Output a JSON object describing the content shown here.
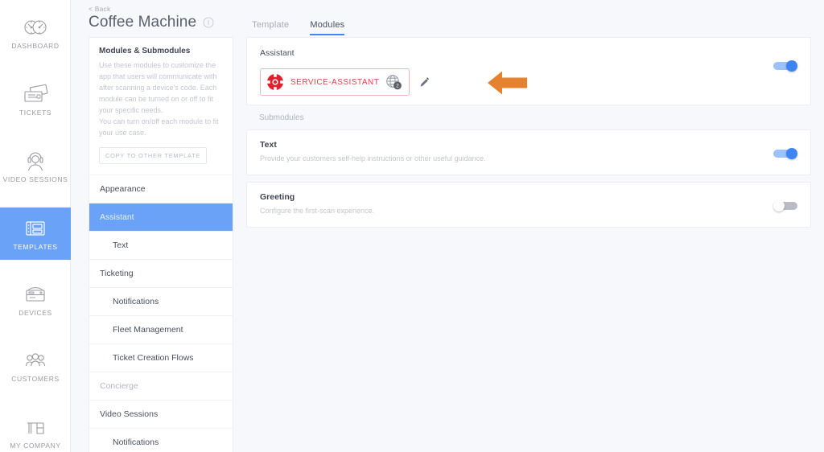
{
  "colors": {
    "accent_blue": "#6aa2f7",
    "tab_underline": "#4287f5",
    "chip_red": "#e0404f",
    "chip_border": "#f0b3bb",
    "toggle_on": "#3d84f5",
    "toggle_off": "#b9bcc6",
    "annotation_orange": "#e5822f",
    "page_bg": "#f7f8fc"
  },
  "rail": {
    "items": [
      {
        "label": "DASHBOARD",
        "icon": "dashboard-gauges-icon",
        "active": false
      },
      {
        "label": "TICKETS",
        "icon": "tickets-icon",
        "active": false
      },
      {
        "label": "VIDEO SESSIONS",
        "icon": "headset-agent-icon",
        "active": false
      },
      {
        "label": "TEMPLATES",
        "icon": "templates-grid-icon",
        "active": true
      },
      {
        "label": "DEVICES",
        "icon": "printer-device-icon",
        "active": false
      },
      {
        "label": "CUSTOMERS",
        "icon": "people-group-icon",
        "active": false
      },
      {
        "label": "MY COMPANY",
        "icon": "desk-icon",
        "active": false
      }
    ]
  },
  "header": {
    "back_label": "< Back",
    "title": "Coffee Machine",
    "info_icon": "info-circle-icon",
    "tabs": [
      {
        "label": "Template",
        "active": false
      },
      {
        "label": "Modules",
        "active": true
      }
    ]
  },
  "left_panel": {
    "title": "Modules & Submodules",
    "description_lines": [
      "Use these modules to customize the",
      "app that users will communicate with",
      "after scanning a device's code. Each",
      "module can be turned on or off to fit",
      "your specific needs.",
      "You can turn on/off each module to fit",
      "your use case."
    ],
    "copy_button_label": "COPY TO OTHER TEMPLATE",
    "nav_items": [
      {
        "label": "Appearance",
        "level": 0,
        "selected": false,
        "muted": false
      },
      {
        "label": "Assistant",
        "level": 0,
        "selected": true,
        "muted": false
      },
      {
        "label": "Text",
        "level": 1,
        "selected": false,
        "muted": false
      },
      {
        "label": "Ticketing",
        "level": 0,
        "selected": false,
        "muted": false
      },
      {
        "label": "Notifications",
        "level": 1,
        "selected": false,
        "muted": false
      },
      {
        "label": "Fleet Management",
        "level": 1,
        "selected": false,
        "muted": false
      },
      {
        "label": "Ticket Creation Flows",
        "level": 1,
        "selected": false,
        "muted": false
      },
      {
        "label": "Concierge",
        "level": 0,
        "selected": false,
        "muted": true
      },
      {
        "label": "Video Sessions",
        "level": 0,
        "selected": false,
        "muted": false
      },
      {
        "label": "Notifications",
        "level": 1,
        "selected": false,
        "muted": false
      }
    ]
  },
  "main": {
    "assistant_card": {
      "label": "Assistant",
      "chip": {
        "icon": "lifebuoy-icon",
        "text": "SERVICE-ASSISTANT",
        "globe_icon": "globe-icon",
        "globe_badge_count": "2"
      },
      "edit_icon": "pencil-edit-icon",
      "toggle_state": "on"
    },
    "submodules_label": "Submodules",
    "submodules": [
      {
        "title": "Text",
        "description": "Provide your customers self-help instructions or other useful guidance.",
        "toggle_state": "on"
      },
      {
        "title": "Greeting",
        "description": "Configure the first-scan experience.",
        "toggle_state": "off"
      }
    ]
  },
  "annotation": {
    "arrow_direction": "left",
    "points_at": "pencil-edit-icon"
  }
}
